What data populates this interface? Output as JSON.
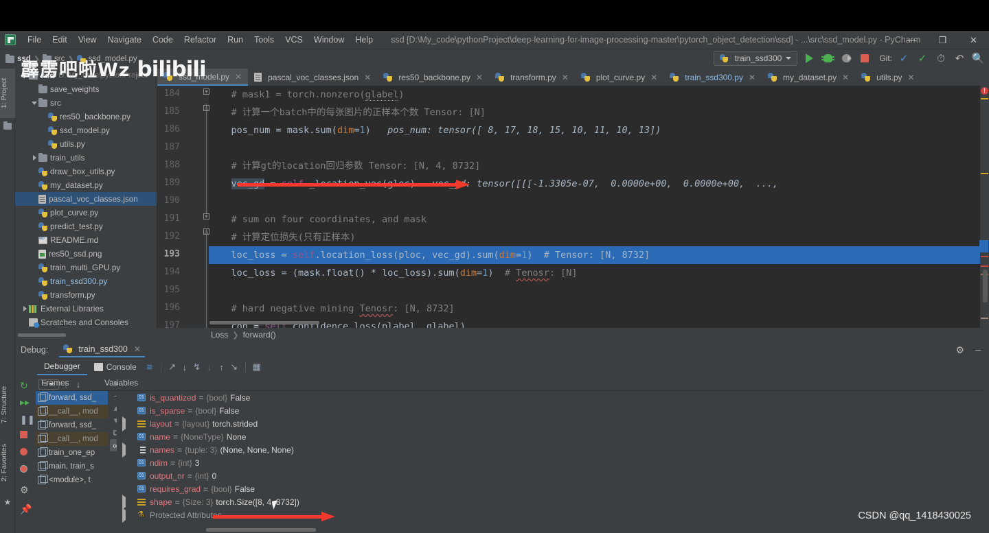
{
  "window": {
    "title": "ssd [D:\\My_code\\pythonProject\\deep-learning-for-image-processing-master\\pytorch_object_detection\\ssd] - ...\\src\\ssd_model.py - PyCharm",
    "minimize": "—",
    "maximize": "❐",
    "close": "✕"
  },
  "menu": [
    "File",
    "Edit",
    "View",
    "Navigate",
    "Code",
    "Refactor",
    "Run",
    "Tools",
    "VCS",
    "Window",
    "Help"
  ],
  "breadcrumb_top": [
    "ssd",
    "src",
    "ssd_model.py"
  ],
  "toolbar": {
    "run_config": "train_ssd300",
    "git_label": "Git:",
    "icons": [
      "run-icon",
      "debug-icon",
      "attach-debugger-icon",
      "stop-icon",
      "git-update-icon",
      "git-commit-icon",
      "history-icon",
      "revert-icon",
      "search-icon"
    ]
  },
  "project": {
    "tab_label": "1: Project",
    "items": [
      {
        "label": "ssd",
        "hint": "D:\\My_code\\pythonProject",
        "icon": "folder-icon",
        "indent": 1,
        "toggle": "down",
        "bold": true
      },
      {
        "label": "save_weights",
        "hint": "",
        "icon": "folder-icon",
        "indent": 2,
        "toggle": "",
        "bold": false
      },
      {
        "label": "src",
        "hint": "",
        "icon": "folder-icon",
        "indent": 2,
        "toggle": "down",
        "bold": false
      },
      {
        "label": "res50_backbone.py",
        "hint": "",
        "icon": "python-icon",
        "indent": 3,
        "toggle": "",
        "bold": false
      },
      {
        "label": "ssd_model.py",
        "hint": "",
        "icon": "python-icon",
        "indent": 3,
        "toggle": "",
        "bold": false
      },
      {
        "label": "utils.py",
        "hint": "",
        "icon": "python-icon",
        "indent": 3,
        "toggle": "",
        "bold": false
      },
      {
        "label": "train_utils",
        "hint": "",
        "icon": "folder-icon",
        "indent": 2,
        "toggle": "right",
        "bold": false
      },
      {
        "label": "draw_box_utils.py",
        "hint": "",
        "icon": "python-icon",
        "indent": 2,
        "toggle": "",
        "bold": false
      },
      {
        "label": "my_dataset.py",
        "hint": "",
        "icon": "python-icon",
        "indent": 2,
        "toggle": "",
        "bold": false
      },
      {
        "label": "pascal_voc_classes.json",
        "hint": "",
        "icon": "json-icon",
        "indent": 2,
        "toggle": "",
        "bold": false,
        "selected": true
      },
      {
        "label": "plot_curve.py",
        "hint": "",
        "icon": "python-icon",
        "indent": 2,
        "toggle": "",
        "bold": false
      },
      {
        "label": "predict_test.py",
        "hint": "",
        "icon": "python-icon",
        "indent": 2,
        "toggle": "",
        "bold": false
      },
      {
        "label": "README.md",
        "hint": "",
        "icon": "markdown-icon",
        "indent": 2,
        "toggle": "",
        "bold": false
      },
      {
        "label": "res50_ssd.png",
        "hint": "",
        "icon": "image-icon",
        "indent": 2,
        "toggle": "",
        "bold": false
      },
      {
        "label": "train_multi_GPU.py",
        "hint": "",
        "icon": "python-icon",
        "indent": 2,
        "toggle": "",
        "bold": false
      },
      {
        "label": "train_ssd300.py",
        "hint": "",
        "icon": "python-icon",
        "indent": 2,
        "toggle": "",
        "bold": false,
        "blue": true
      },
      {
        "label": "transform.py",
        "hint": "",
        "icon": "python-icon",
        "indent": 2,
        "toggle": "",
        "bold": false
      },
      {
        "label": "External Libraries",
        "hint": "",
        "icon": "library-icon",
        "indent": 1,
        "toggle": "right",
        "bold": false
      },
      {
        "label": "Scratches and Consoles",
        "hint": "",
        "icon": "scratches-icon",
        "indent": 1,
        "toggle": "",
        "bold": false
      }
    ]
  },
  "sidebar_vtabs": [
    {
      "label": "1: Project",
      "active": true
    },
    {
      "label": "7: Structure",
      "active": false
    },
    {
      "label": "2: Favorites",
      "active": false
    }
  ],
  "editor": {
    "tabs": [
      {
        "label": "ssd_model.py",
        "icon": "python-icon",
        "active": true,
        "blue": false
      },
      {
        "label": "pascal_voc_classes.json",
        "icon": "json-icon",
        "active": false,
        "blue": false
      },
      {
        "label": "res50_backbone.py",
        "icon": "python-icon",
        "active": false,
        "blue": false
      },
      {
        "label": "transform.py",
        "icon": "python-icon",
        "active": false,
        "blue": false
      },
      {
        "label": "plot_curve.py",
        "icon": "python-icon",
        "active": false,
        "blue": false
      },
      {
        "label": "train_ssd300.py",
        "icon": "python-icon",
        "active": false,
        "blue": true
      },
      {
        "label": "my_dataset.py",
        "icon": "python-icon",
        "active": false,
        "blue": false
      },
      {
        "label": "utils.py",
        "icon": "python-icon",
        "active": false,
        "blue": false
      }
    ],
    "line_numbers": [
      "184",
      "185",
      "186",
      "187",
      "188",
      "189",
      "190",
      "191",
      "192",
      "193",
      "194",
      "195",
      "196",
      "197"
    ],
    "current_line": "193",
    "breadcrumb": [
      "Loss",
      "forward()"
    ],
    "lines": [
      {
        "n": "184",
        "text": "    # mask1 = torch.nonzero(glabel)"
      },
      {
        "n": "185",
        "text": "    # 计算一个batch中的每张图片的正样本个数 Tensor: [N]"
      },
      {
        "n": "186",
        "text": "    pos_num = mask.sum(dim=1)",
        "inline": "pos_num: tensor([ 8, 17, 18, 15, 10, 11, 10, 13])"
      },
      {
        "n": "187",
        "text": ""
      },
      {
        "n": "188",
        "text": "    # 计算gt的location回归参数 Tensor: [N, 4, 8732]"
      },
      {
        "n": "189",
        "text": "    vec_gd = self._location_vec(gloc)",
        "inline": "vec_gd: tensor([[[-1.3305e-07,  0.0000e+00,  0.0000e+00,  ...,"
      },
      {
        "n": "190",
        "text": ""
      },
      {
        "n": "191",
        "text": "    # sum on four coordinates, and mask"
      },
      {
        "n": "192",
        "text": "    # 计算定位损失(只有正样本)"
      },
      {
        "n": "193",
        "text": "    loc_loss = self.location_loss(ploc, vec_gd).sum(dim=1)  # Tensor: [N, 8732]"
      },
      {
        "n": "194",
        "text": "    loc_loss = (mask.float() * loc_loss).sum(dim=1)  # Tenosr: [N]"
      },
      {
        "n": "195",
        "text": ""
      },
      {
        "n": "196",
        "text": "    # hard negative mining Tenosr: [N, 8732]"
      },
      {
        "n": "197",
        "text": "    con = self.confidence_loss(plabel, glabel)"
      }
    ]
  },
  "debug": {
    "label": "Debug:",
    "session_tab": "train_ssd300",
    "subtabs": [
      {
        "label": "Debugger",
        "active": true,
        "icon": ""
      },
      {
        "label": "Console",
        "active": false,
        "icon": "console-icon"
      }
    ],
    "toolbar_icons": [
      "mute-breakpoints-icon",
      "step-over-icon",
      "step-into-icon",
      "force-step-into-icon",
      "step-into-my-code-icon",
      "step-out-icon",
      "run-to-cursor-icon",
      "evaluate-expression-icon"
    ],
    "left_icons": [
      "rerun-icon",
      "resume-icon",
      "pause-icon",
      "stop-icon",
      "view-breakpoints-icon",
      "mute-breakpoints-icon",
      "settings-icon",
      "pin-icon"
    ],
    "columns": {
      "frames": "Frames",
      "variables": "Variables"
    },
    "frames": [
      {
        "label": "forward, ssd_",
        "selected": true,
        "library": false
      },
      {
        "label": "__call__, mod",
        "selected": false,
        "library": true
      },
      {
        "label": "forward, ssd_",
        "selected": false,
        "library": false
      },
      {
        "label": "__call__, mod",
        "selected": false,
        "library": true
      },
      {
        "label": "train_one_ep",
        "selected": false,
        "library": false
      },
      {
        "label": "main, train_s",
        "selected": false,
        "library": false
      },
      {
        "label": "<module>, t",
        "selected": false,
        "library": false
      }
    ],
    "variables": [
      {
        "toggle": "",
        "icon": "bool-icon",
        "name": "is_quantized",
        "type": "{bool}",
        "value": "False"
      },
      {
        "toggle": "",
        "icon": "bool-icon",
        "name": "is_sparse",
        "type": "{bool}",
        "value": "False"
      },
      {
        "toggle": "right",
        "icon": "list-icon",
        "name": "layout",
        "type": "{layout}",
        "value": "torch.strided"
      },
      {
        "toggle": "",
        "icon": "bool-icon",
        "name": "name",
        "type": "{NoneType}",
        "value": "None"
      },
      {
        "toggle": "right",
        "icon": "tuple-icon",
        "name": "names",
        "type": "{tuple: 3}",
        "value": "(None, None, None)"
      },
      {
        "toggle": "",
        "icon": "bool-icon",
        "name": "ndim",
        "type": "{int}",
        "value": "3"
      },
      {
        "toggle": "",
        "icon": "bool-icon",
        "name": "output_nr",
        "type": "{int}",
        "value": "0"
      },
      {
        "toggle": "",
        "icon": "bool-icon",
        "name": "requires_grad",
        "type": "{bool}",
        "value": "False"
      },
      {
        "toggle": "right",
        "icon": "list-icon",
        "name": "shape",
        "type": "{Size: 3}",
        "value": "torch.Size([8, 4, 8732])"
      },
      {
        "toggle": "right",
        "icon": "protected-icon",
        "name": "Protected Attributes",
        "type": "",
        "value": ""
      }
    ]
  },
  "watermarks": {
    "bilibili": "霹雳吧啦Wz",
    "bilibili_logo": "bilibili",
    "csdn": "CSDN @qq_1418430025"
  },
  "colors": {
    "accent_blue": "#4a88c7",
    "selection_blue": "#2b6bb5",
    "arrow_red": "#f03a2e",
    "editor_bg": "#2b2b2b",
    "panel_bg": "#3c3f41"
  }
}
